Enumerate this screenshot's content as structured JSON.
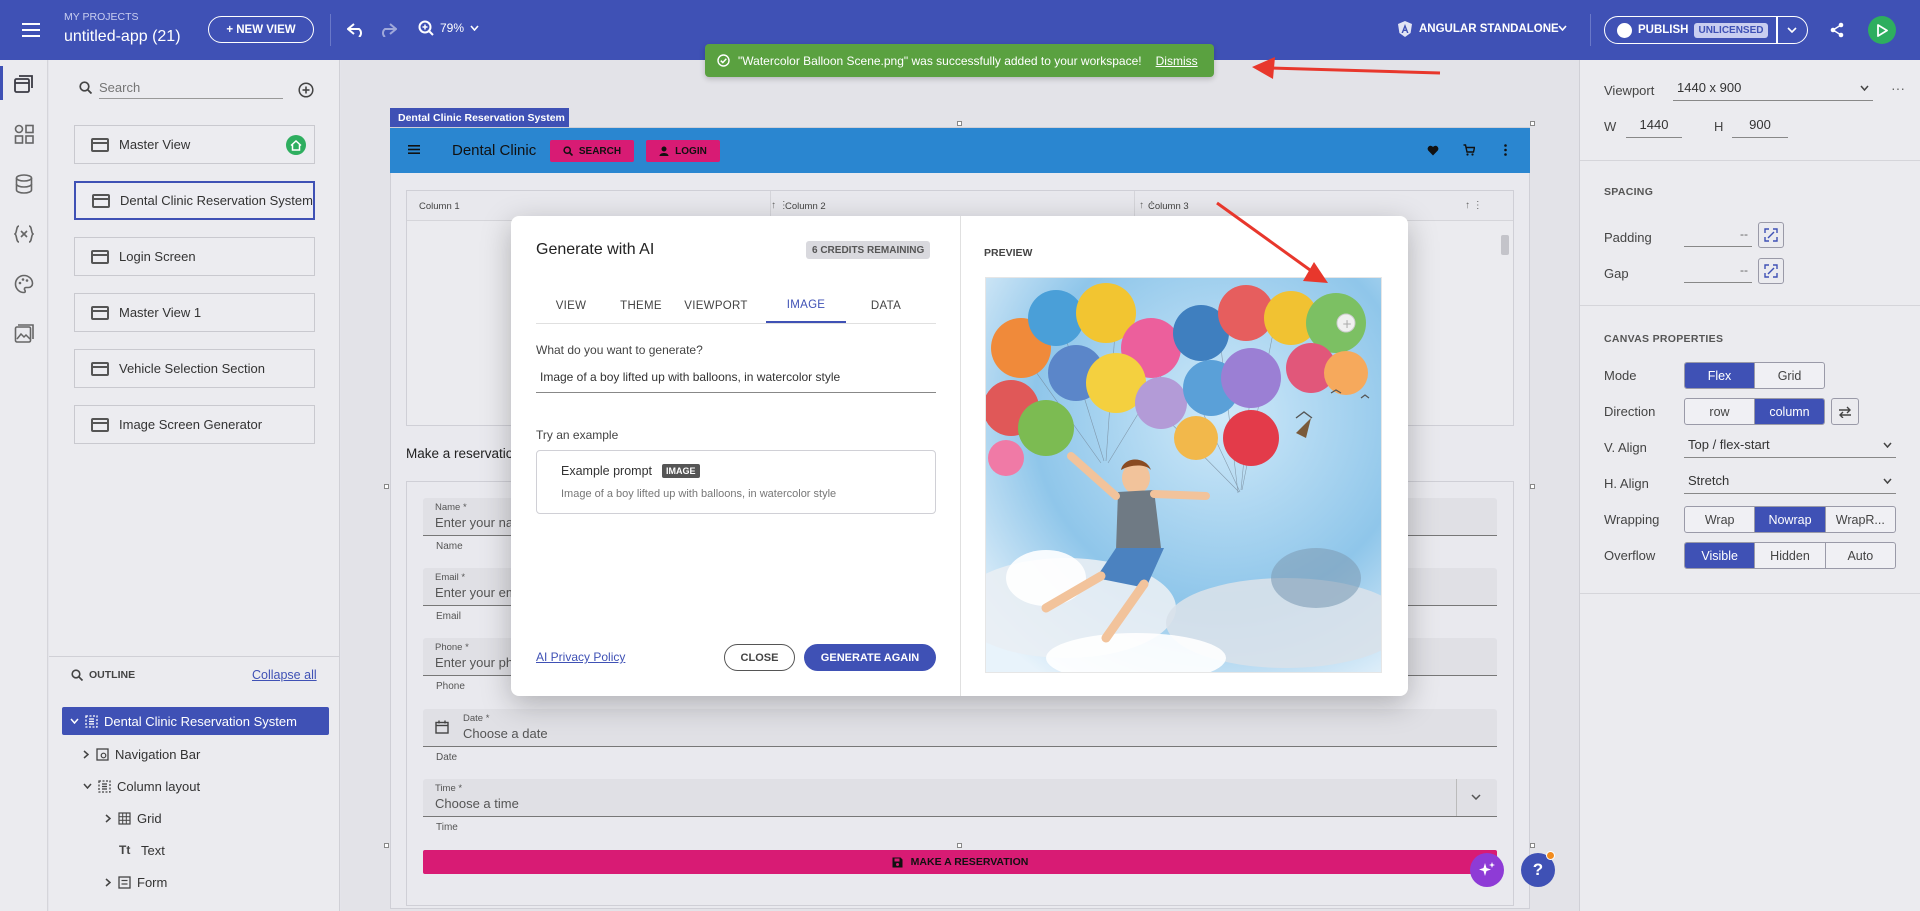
{
  "topbar": {
    "projects_label": "MY PROJECTS",
    "app_title": "untitled-app (21)",
    "new_view_label": "+ NEW VIEW",
    "zoom": "79%",
    "framework": "ANGULAR STANDALONE",
    "publish_label": "PUBLISH",
    "license_badge": "UNLICENSED"
  },
  "toast": {
    "message": "\"Watercolor Balloon Scene.png\" was successfully added to your workspace!",
    "dismiss": "Dismiss"
  },
  "left": {
    "search_placeholder": "Search",
    "views": [
      {
        "label": "Master View"
      },
      {
        "label": "Dental Clinic Reservation System"
      },
      {
        "label": "Login Screen"
      },
      {
        "label": "Master View 1"
      },
      {
        "label": "Vehicle Selection Section"
      },
      {
        "label": "Image Screen Generator"
      }
    ],
    "outline_title": "OUTLINE",
    "collapse_all": "Collapse all",
    "outline": [
      {
        "label": "Dental Clinic Reservation System"
      },
      {
        "label": "Navigation Bar"
      },
      {
        "label": "Column layout"
      },
      {
        "label": "Grid"
      },
      {
        "label": "Text"
      },
      {
        "label": "Form"
      }
    ]
  },
  "canvas": {
    "frame_label": "Dental Clinic Reservation System",
    "app_title": "Dental Clinic",
    "search_btn": "SEARCH",
    "login_btn": "LOGIN",
    "columns": [
      "Column 1",
      "Column 2",
      "Column 3"
    ],
    "reservation_text": "Make a reservation",
    "fields": [
      {
        "label": "Name *",
        "placeholder": "Enter your name",
        "helper": "Name"
      },
      {
        "label": "Email *",
        "placeholder": "Enter your email",
        "helper": "Email"
      },
      {
        "label": "Phone *",
        "placeholder": "Enter your phone",
        "helper": "Phone"
      },
      {
        "label": "Date *",
        "placeholder": "Choose a date",
        "helper": "Date"
      },
      {
        "label": "Time *",
        "placeholder": "Choose a time",
        "helper": "Time"
      }
    ],
    "submit_btn": "MAKE A RESERVATION"
  },
  "modal": {
    "title": "Generate with AI",
    "credits": "6 CREDITS REMAINING",
    "tabs": [
      "VIEW",
      "THEME",
      "VIEWPORT",
      "IMAGE",
      "DATA"
    ],
    "active_tab": "IMAGE",
    "prompt_label": "What do you want to generate?",
    "prompt_value": "Image of a boy lifted up with balloons, in watercolor style",
    "example_heading": "Try an example",
    "example_title": "Example prompt",
    "example_badge": "IMAGE",
    "example_text": "Image of a boy lifted up with balloons, in watercolor style",
    "privacy_link": "AI Privacy Policy",
    "close_btn": "CLOSE",
    "generate_btn": "GENERATE AGAIN",
    "preview_label": "PREVIEW"
  },
  "right": {
    "viewport_label": "Viewport",
    "viewport_value": "1440 x 900",
    "w_label": "W",
    "w_value": "1440",
    "h_label": "H",
    "h_value": "900",
    "spacing_title": "SPACING",
    "padding_label": "Padding",
    "padding_value": "--",
    "gap_label": "Gap",
    "gap_value": "--",
    "canvas_title": "CANVAS PROPERTIES",
    "mode_label": "Mode",
    "mode_options": [
      "Flex",
      "Grid"
    ],
    "direction_label": "Direction",
    "direction_options": [
      "row",
      "column"
    ],
    "valign_label": "V. Align",
    "valign_value": "Top / flex-start",
    "halign_label": "H. Align",
    "halign_value": "Stretch",
    "wrapping_label": "Wrapping",
    "wrapping_options": [
      "Wrap",
      "Nowrap",
      "WrapR..."
    ],
    "overflow_label": "Overflow",
    "overflow_options": [
      "Visible",
      "Hidden",
      "Auto"
    ]
  },
  "colors": {
    "primary": "#3f51b5",
    "app_bar": "#2a86d0",
    "pink": "#d81b74",
    "toast": "#5aa140"
  }
}
